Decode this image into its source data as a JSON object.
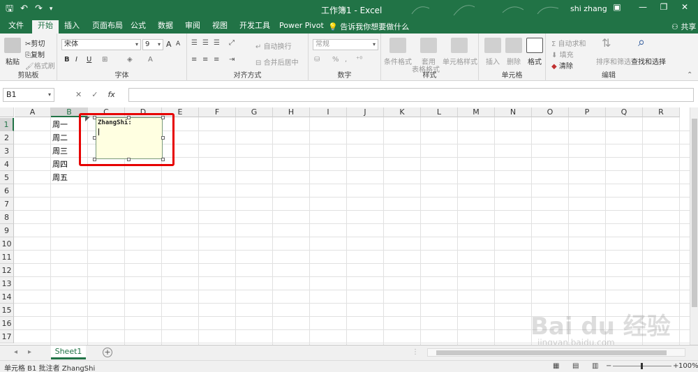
{
  "window": {
    "title": "工作簿1  -  Excel",
    "user": "shi zhang",
    "qat": {
      "save_icon": "save-icon",
      "undo_icon": "undo-icon",
      "redo_icon": "redo-icon",
      "customize_icon": "customize-icon"
    },
    "controls": {
      "ribbon_options": "ribbon-display-icon",
      "minimize": "—",
      "maximize": "❐",
      "close": "✕"
    }
  },
  "tabs": {
    "items": [
      "文件",
      "开始",
      "插入",
      "页面布局",
      "公式",
      "数据",
      "审阅",
      "视图",
      "开发工具",
      "Power Pivot"
    ],
    "active": "开始",
    "tell_me": "告诉我你想要做什么",
    "share": "共享"
  },
  "ribbon": {
    "clipboard": {
      "label": "剪贴板",
      "paste": "粘贴",
      "cut": "剪切",
      "copy": "复制",
      "format_painter": "格式刷"
    },
    "font": {
      "label": "字体",
      "font_name": "宋体",
      "font_size": "9",
      "bold": "B",
      "italic": "I",
      "underline": "U",
      "grow": "A",
      "shrink": "A"
    },
    "alignment": {
      "label": "对齐方式",
      "wrap": "自动换行",
      "merge": "合并后居中"
    },
    "number": {
      "label": "数字",
      "format": "常规",
      "percent": "%",
      "comma": ","
    },
    "styles": {
      "label": "样式",
      "conditional": "条件格式",
      "table1": "套用",
      "table2": "表格格式",
      "cell_styles": "单元格样式"
    },
    "cells": {
      "label": "单元格",
      "insert": "插入",
      "delete": "删除",
      "format": "格式"
    },
    "editing": {
      "label": "编辑",
      "autosum": "自动求和",
      "fill": "填充",
      "clear": "清除",
      "sort": "排序和筛选",
      "find": "查找和选择"
    }
  },
  "formula_bar": {
    "name_box": "B1",
    "fx": "fx",
    "cancel": "✕",
    "enter": "✓",
    "value": ""
  },
  "grid": {
    "columns": [
      "A",
      "B",
      "C",
      "D",
      "E",
      "F",
      "G",
      "H",
      "I",
      "J",
      "K",
      "L",
      "M",
      "N",
      "O",
      "P",
      "Q",
      "R"
    ],
    "rows": [
      "1",
      "2",
      "3",
      "4",
      "5",
      "6",
      "7",
      "8",
      "9",
      "10",
      "11",
      "12",
      "13",
      "14",
      "15",
      "16",
      "17"
    ],
    "cells": [
      {
        "ref": "B1",
        "value": "周一"
      },
      {
        "ref": "B2",
        "value": "周二"
      },
      {
        "ref": "B3",
        "value": "周三"
      },
      {
        "ref": "B4",
        "value": "周四"
      },
      {
        "ref": "B5",
        "value": "周五"
      }
    ]
  },
  "comment": {
    "author": "ZhangShi:",
    "text": ""
  },
  "sheets": {
    "tabs": [
      "Sheet1"
    ],
    "active": "Sheet1",
    "add": "+"
  },
  "status": {
    "message": "单元格 B1 批注者 ZhangShi",
    "zoom": "100%"
  },
  "watermark": {
    "brand": "Bai du 经验",
    "url": "jingyan.baidu.com"
  },
  "colors": {
    "excel_green": "#217346",
    "highlight_red": "#e60000",
    "comment_bg": "#ffffe1"
  }
}
